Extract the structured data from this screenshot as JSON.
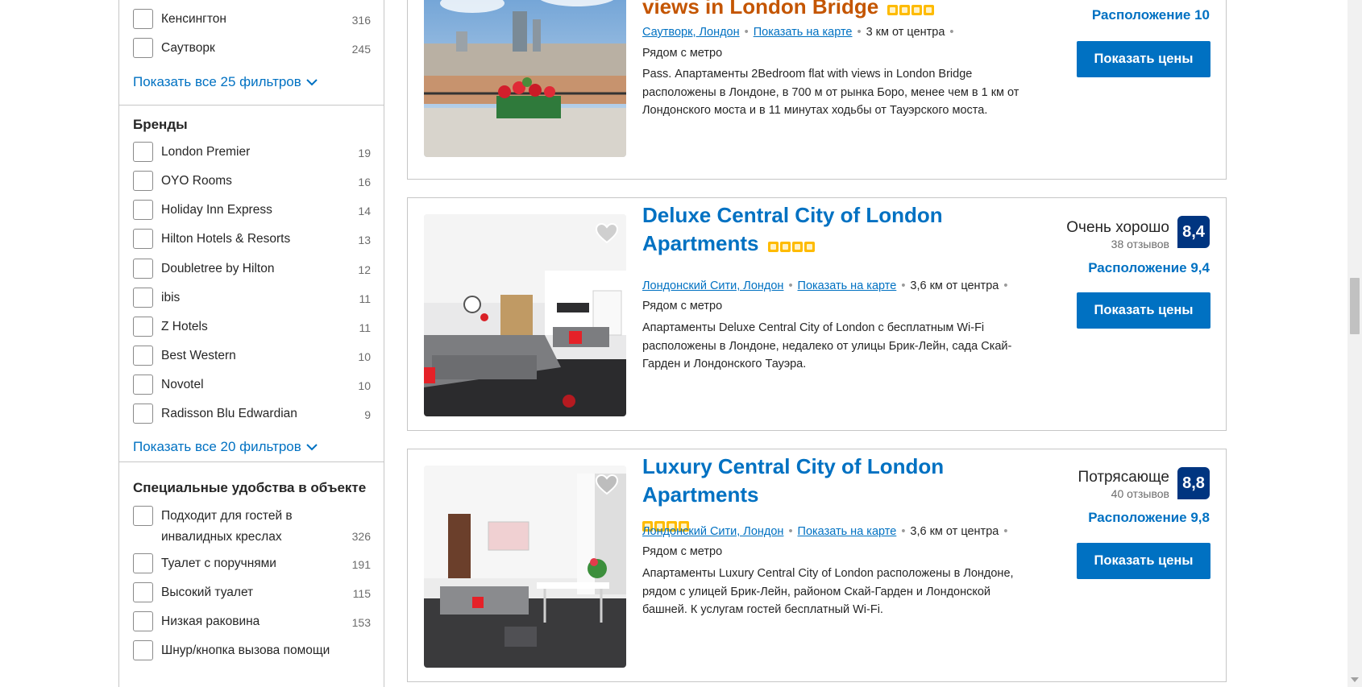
{
  "sidebar": {
    "districts": {
      "items": [
        {
          "label": "Кенсингтон",
          "count": "316"
        },
        {
          "label": "Саутворк",
          "count": "245"
        }
      ],
      "show_all": "Показать все 25 фильтров"
    },
    "brands": {
      "heading": "Бренды",
      "items": [
        {
          "label": "London Premier",
          "count": "19"
        },
        {
          "label": "OYO Rooms",
          "count": "16"
        },
        {
          "label": "Holiday Inn Express",
          "count": "14"
        },
        {
          "label": "Hilton Hotels & Resorts",
          "count": "13"
        },
        {
          "label": "Doubletree by Hilton",
          "count": "12"
        },
        {
          "label": "ibis",
          "count": "11"
        },
        {
          "label": "Z Hotels",
          "count": "11"
        },
        {
          "label": "Best Western",
          "count": "10"
        },
        {
          "label": "Novotel",
          "count": "10"
        },
        {
          "label": "Radisson Blu Edwardian",
          "count": "9"
        }
      ],
      "show_all": "Показать все 20 фильтров"
    },
    "accessibility": {
      "heading": "Специальные удобства в объекте",
      "items": [
        {
          "label": "Подходит для гостей в инвалидных креслах",
          "count": "326"
        },
        {
          "label": "Туалет с поручнями",
          "count": "191"
        },
        {
          "label": "Высокий туалет",
          "count": "115"
        },
        {
          "label": "Низкая раковина",
          "count": "153"
        },
        {
          "label": "Шнур/кнопка вызова помощи",
          "count": ""
        }
      ]
    }
  },
  "results": [
    {
      "title": "views in London Bridge",
      "stars": 4,
      "district_link": "Саутворк, Лондон",
      "map_link": "Показать на карте",
      "distance": "3 км от центра",
      "metro": "Рядом с метро",
      "description": "Pass. Апартаменты 2Bedroom flat with views in London Bridge расположены в Лондоне, в 700 м от рынка Боро, менее чем в 1 км от Лондонского моста и в 11 минутах ходьбы от Тауэрского моста.",
      "location_score": "Расположение 10",
      "cta": "Показать цены"
    },
    {
      "title": "Deluxe Central City of London Apartments",
      "stars": 4,
      "district_link": "Лондонский Сити, Лондон",
      "map_link": "Показать на карте",
      "distance": "3,6 км от центра",
      "metro": "Рядом с метро",
      "description": "Апартаменты Deluxe Central City of London с бесплатным Wi-Fi расположены в Лондоне, недалеко от улицы Брик-Лейн, сада Скай-Гарден и Лондонского Тауэра.",
      "rating_word": "Очень хорошо",
      "reviews": "38 отзывов",
      "score": "8,4",
      "location_score": "Расположение 9,4",
      "cta": "Показать цены"
    },
    {
      "title": "Luxury Central City of London Apartments",
      "stars": 4,
      "district_link": "Лондонский Сити, Лондон",
      "map_link": "Показать на карте",
      "distance": "3,6 км от центра",
      "metro": "Рядом с метро",
      "description": "Апартаменты Luxury Central City of London расположены в Лондоне, рядом с улицей Брик-Лейн, районом Скай-Гарден и Лондонской башней. К услугам гостей бесплатный Wi-Fi.",
      "rating_word": "Потрясающе",
      "reviews": "40 отзывов",
      "score": "8,8",
      "location_score": "Расположение 9,8",
      "cta": "Показать цены"
    }
  ],
  "colors": {
    "link_blue": "#0071c2",
    "score_navy": "#003580",
    "star_yellow": "#febb02",
    "visited_title": "#c45500"
  }
}
